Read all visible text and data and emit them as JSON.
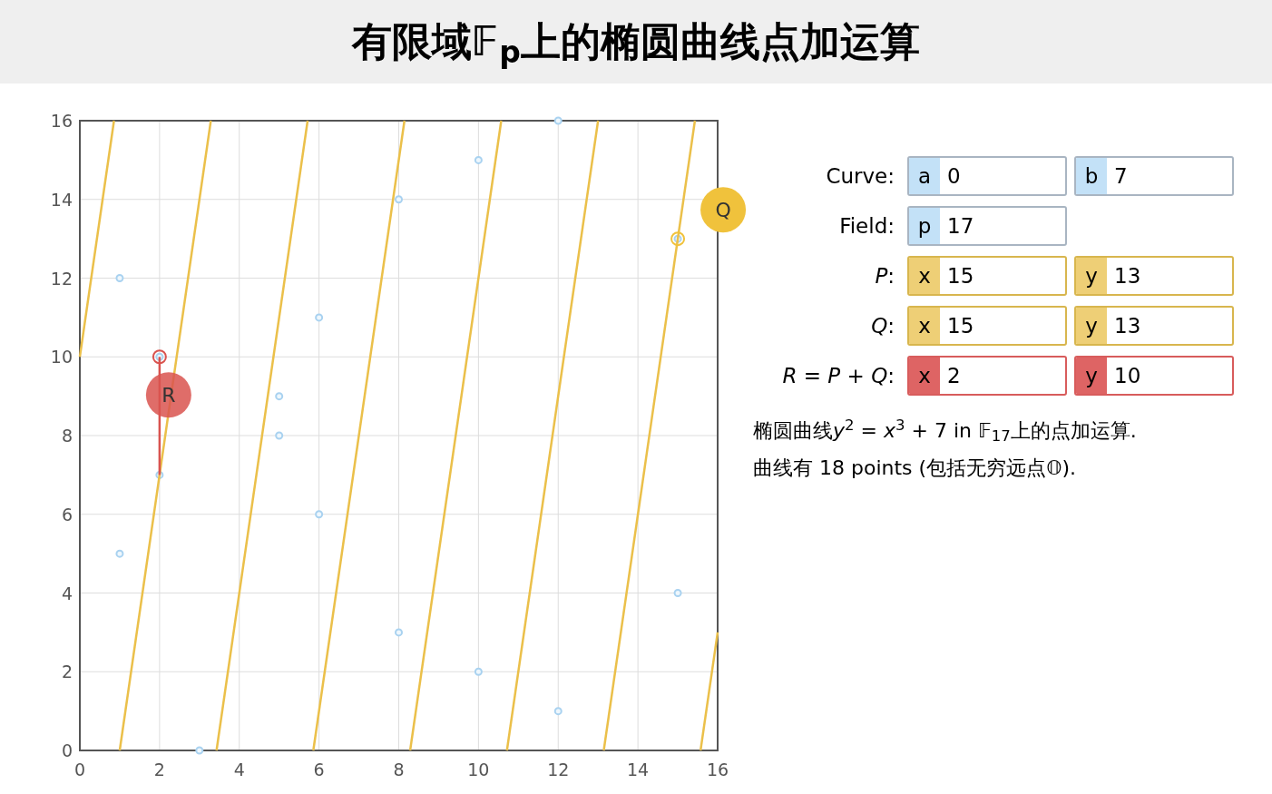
{
  "title": "有限域𝔽$_{p}$上的椭圆曲线点加运算",
  "chart_data": {
    "type": "scatter",
    "grid": true,
    "xlim": [
      0,
      16
    ],
    "ylim": [
      0,
      16
    ],
    "xticks": [
      {
        "value": 0,
        "label": "0"
      },
      {
        "value": 2,
        "label": "2"
      },
      {
        "value": 4,
        "label": "4"
      },
      {
        "value": 6,
        "label": "6"
      },
      {
        "value": 8,
        "label": "8"
      },
      {
        "value": 10,
        "label": "10"
      },
      {
        "value": 12,
        "label": "12"
      },
      {
        "value": 14,
        "label": "14"
      },
      {
        "value": 16,
        "label": "16"
      }
    ],
    "yticks": [
      {
        "value": 0,
        "label": "0"
      },
      {
        "value": 2,
        "label": "2"
      },
      {
        "value": 4,
        "label": "4"
      },
      {
        "value": 6,
        "label": "6"
      },
      {
        "value": 8,
        "label": "8"
      },
      {
        "value": 10,
        "label": "10"
      },
      {
        "value": 12,
        "label": "12"
      },
      {
        "value": 14,
        "label": "14"
      },
      {
        "value": 16,
        "label": "16"
      }
    ],
    "x": [
      1,
      1,
      2,
      2,
      3,
      5,
      5,
      6,
      6,
      8,
      8,
      10,
      10,
      12,
      12,
      15,
      15,
      0,
      0.857,
      1,
      3.286,
      3.429,
      5.714,
      5.857,
      8.143,
      8.286,
      10.571,
      10.714,
      13,
      13.143,
      15.429,
      15.571,
      16,
      2,
      2
    ],
    "series": [
      {
        "type": "scatter",
        "color": "#a9d2f0",
        "values": [
          12,
          5,
          10,
          7,
          0,
          9,
          8,
          11,
          6,
          14,
          3,
          15,
          2,
          16,
          1,
          13,
          4,
          null,
          null,
          null,
          null,
          null,
          null,
          null,
          null,
          null,
          null,
          null,
          null,
          null,
          null,
          null,
          null,
          null,
          null
        ]
      },
      {
        "type": "line",
        "color": "#ebc04a",
        "values": [
          null,
          null,
          null,
          null,
          null,
          null,
          null,
          null,
          null,
          null,
          null,
          null,
          null,
          null,
          null,
          null,
          null,
          10,
          16,
          null,
          null,
          null,
          null,
          null,
          null,
          null,
          null,
          null,
          null,
          null,
          null,
          null,
          null,
          null,
          null
        ]
      },
      {
        "type": "line",
        "color": "#ebc04a",
        "values": [
          null,
          null,
          null,
          null,
          null,
          null,
          null,
          null,
          null,
          null,
          null,
          null,
          null,
          null,
          null,
          null,
          null,
          null,
          null,
          0,
          16,
          null,
          null,
          null,
          null,
          null,
          null,
          null,
          null,
          null,
          null,
          null,
          null,
          null,
          null
        ]
      },
      {
        "type": "line",
        "color": "#ebc04a",
        "values": [
          null,
          null,
          null,
          null,
          null,
          null,
          null,
          null,
          null,
          null,
          null,
          null,
          null,
          null,
          null,
          null,
          null,
          null,
          null,
          null,
          null,
          0,
          16,
          null,
          null,
          null,
          null,
          null,
          null,
          null,
          null,
          null,
          null,
          null,
          null
        ]
      },
      {
        "type": "line",
        "color": "#ebc04a",
        "values": [
          null,
          null,
          null,
          null,
          null,
          null,
          null,
          null,
          null,
          null,
          null,
          null,
          null,
          null,
          null,
          null,
          null,
          null,
          null,
          null,
          null,
          null,
          null,
          0,
          16,
          null,
          null,
          null,
          null,
          null,
          null,
          null,
          null,
          null,
          null
        ]
      },
      {
        "type": "line",
        "color": "#ebc04a",
        "values": [
          null,
          null,
          null,
          null,
          null,
          null,
          null,
          null,
          null,
          null,
          null,
          null,
          null,
          null,
          null,
          null,
          null,
          null,
          null,
          null,
          null,
          null,
          null,
          null,
          null,
          0,
          16,
          null,
          null,
          null,
          null,
          null,
          null,
          null,
          null
        ]
      },
      {
        "type": "line",
        "color": "#ebc04a",
        "values": [
          null,
          null,
          null,
          null,
          null,
          null,
          null,
          null,
          null,
          null,
          null,
          null,
          null,
          null,
          null,
          null,
          null,
          null,
          null,
          null,
          null,
          null,
          null,
          null,
          null,
          null,
          null,
          0,
          16,
          null,
          null,
          null,
          null,
          null,
          null
        ]
      },
      {
        "type": "line",
        "color": "#ebc04a",
        "values": [
          null,
          null,
          null,
          null,
          null,
          null,
          null,
          null,
          null,
          null,
          null,
          null,
          null,
          null,
          null,
          null,
          null,
          null,
          null,
          null,
          null,
          null,
          null,
          null,
          null,
          null,
          null,
          null,
          null,
          0,
          16,
          null,
          null,
          null,
          null
        ]
      },
      {
        "type": "line",
        "color": "#ebc04a",
        "values": [
          null,
          null,
          null,
          null,
          null,
          null,
          null,
          null,
          null,
          null,
          null,
          null,
          null,
          null,
          null,
          null,
          null,
          null,
          null,
          null,
          null,
          null,
          null,
          null,
          null,
          null,
          null,
          null,
          null,
          null,
          null,
          0,
          3,
          null,
          null
        ]
      },
      {
        "type": "line",
        "color": "#d9534f",
        "values": [
          null,
          null,
          null,
          null,
          null,
          null,
          null,
          null,
          null,
          null,
          null,
          null,
          null,
          null,
          null,
          null,
          null,
          null,
          null,
          null,
          null,
          null,
          null,
          null,
          null,
          null,
          null,
          null,
          null,
          null,
          null,
          null,
          null,
          10,
          7
        ]
      }
    ],
    "annotations": [
      {
        "text": "Q",
        "x": 15,
        "y": 13
      },
      {
        "text": "R",
        "x": 2,
        "y": 10
      }
    ]
  },
  "form": [
    {
      "label": "Curve:",
      "fields": [
        {
          "prefix": "a",
          "value": "0",
          "kind": "param"
        },
        {
          "prefix": "b",
          "value": "7",
          "kind": "param"
        }
      ]
    },
    {
      "label": "Field:",
      "fields": [
        {
          "prefix": "p",
          "value": "17",
          "kind": "param"
        }
      ]
    },
    {
      "label": "*P*:",
      "fields": [
        {
          "prefix": "x",
          "value": "15",
          "kind": "input"
        },
        {
          "prefix": "y",
          "value": "13",
          "kind": "input"
        }
      ]
    },
    {
      "label": "*Q*:",
      "fields": [
        {
          "prefix": "x",
          "value": "15",
          "kind": "input"
        },
        {
          "prefix": "y",
          "value": "13",
          "kind": "input"
        }
      ]
    },
    {
      "label": "*R* = *P* + *Q*:",
      "fields": [
        {
          "prefix": "x",
          "value": "2",
          "kind": "result"
        },
        {
          "prefix": "y",
          "value": "10",
          "kind": "result"
        }
      ]
    }
  ],
  "description": [
    {
      "lead": "椭圆曲线",
      "rest": "*y*$^{2}$ = *x*$^{3}$ + 7 in 𝔽$_{17}$上的点加运算."
    },
    {
      "lead": "曲线有 18 points (包括无穷远点𝕆)."
    }
  ]
}
